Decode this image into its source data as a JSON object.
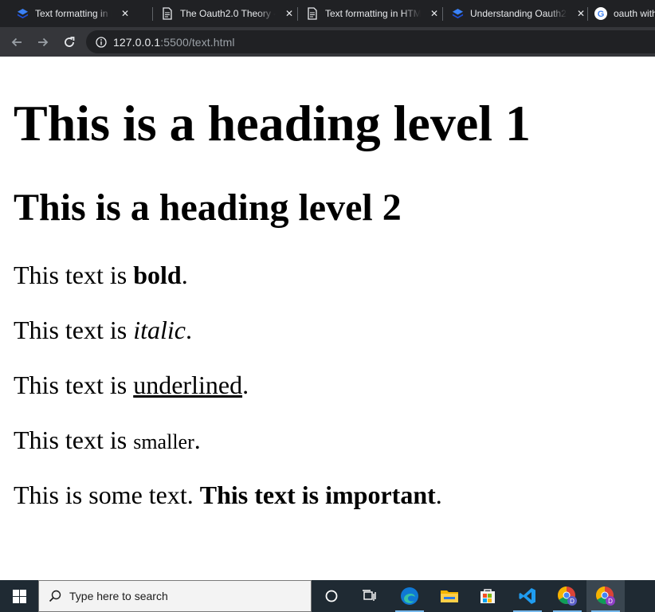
{
  "browser": {
    "tabs": [
      {
        "title": "Text formatting in HTML",
        "favicon": "stack-icon"
      },
      {
        "title": "The Oauth2.0 Theory - ",
        "favicon": "page-icon"
      },
      {
        "title": "Text formatting in HTML",
        "favicon": "page-icon"
      },
      {
        "title": "Understanding Oauth2",
        "favicon": "stack-icon"
      },
      {
        "title": "oauth with",
        "favicon": "google-icon"
      }
    ],
    "address": {
      "host": "127.0.0.1",
      "rest": ":5500/text.html"
    }
  },
  "page": {
    "h1": "This is a heading level 1",
    "h2": "This is a heading level 2",
    "bold_line": {
      "prefix": "This text is ",
      "em": "bold",
      "suffix": "."
    },
    "italic_line": {
      "prefix": "This text is ",
      "em": "italic",
      "suffix": "."
    },
    "underline_line": {
      "prefix": "This text is ",
      "em": "underlined",
      "suffix": "."
    },
    "small_line": {
      "prefix": "This text is ",
      "em": "smaller",
      "suffix": "."
    },
    "strong_line": {
      "prefix": "This is some text. ",
      "em": "This text is important",
      "suffix": "."
    }
  },
  "taskbar": {
    "search_placeholder": "Type here to search",
    "icons": [
      "windows-start-icon",
      "cortana-icon",
      "task-view-icon",
      "edge-icon",
      "file-explorer-icon",
      "store-icon",
      "vscode-icon",
      "chrome-profile-icon",
      "chrome-profile-active-icon"
    ]
  },
  "colors": {
    "tabstrip": "#202124",
    "toolbar": "#35363a",
    "taskbar": "#1f2a33",
    "accent_blue": "#1a73e8"
  }
}
